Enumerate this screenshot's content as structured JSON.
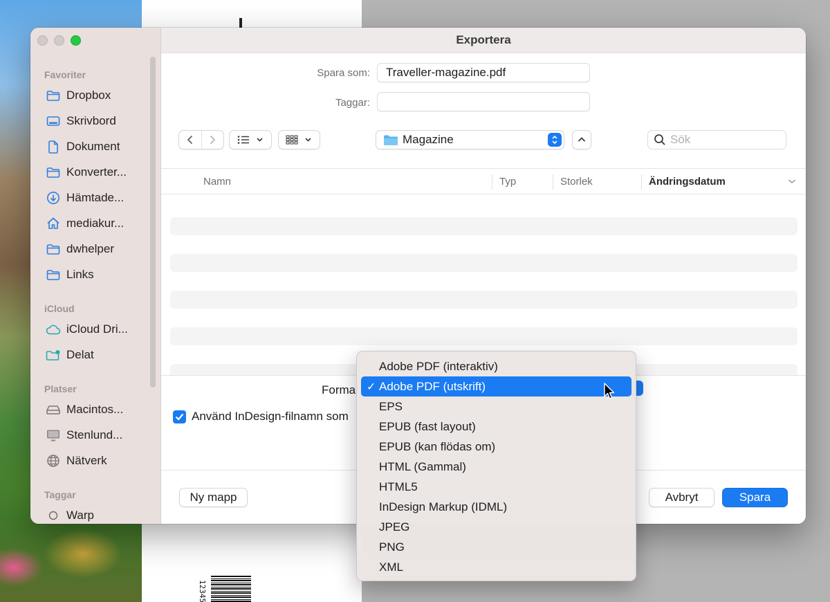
{
  "window": {
    "title": "Exportera"
  },
  "sidebar": {
    "sections": [
      {
        "title": "Favoriter",
        "items": [
          {
            "label": "Dropbox",
            "icon": "folder-icon"
          },
          {
            "label": "Skrivbord",
            "icon": "desktop-icon"
          },
          {
            "label": "Dokument",
            "icon": "document-icon"
          },
          {
            "label": "Konverter...",
            "icon": "folder-icon"
          },
          {
            "label": "Hämtade...",
            "icon": "download-icon"
          },
          {
            "label": "mediakur...",
            "icon": "home-icon"
          },
          {
            "label": "dwhelper",
            "icon": "folder-icon"
          },
          {
            "label": "Links",
            "icon": "folder-icon"
          }
        ]
      },
      {
        "title": "iCloud",
        "items": [
          {
            "label": "iCloud Dri...",
            "icon": "cloud-icon"
          },
          {
            "label": "Delat",
            "icon": "shared-folder-icon"
          }
        ]
      },
      {
        "title": "Platser",
        "items": [
          {
            "label": "Macintos...",
            "icon": "hard-drive-icon"
          },
          {
            "label": "Stenlund...",
            "icon": "monitor-icon"
          },
          {
            "label": "Nätverk",
            "icon": "globe-icon"
          }
        ]
      },
      {
        "title": "Taggar",
        "items": [
          {
            "label": "Warp",
            "icon": "tag-circle-icon"
          }
        ]
      }
    ]
  },
  "form": {
    "save_as_label": "Spara som:",
    "save_as_value": "Traveller-magazine.pdf",
    "tags_label": "Taggar:",
    "tags_value": ""
  },
  "toolbar": {
    "location": "Magazine",
    "search_placeholder": "Sök"
  },
  "columns": [
    "Namn",
    "Typ",
    "Storlek",
    "Ändringsdatum"
  ],
  "options": {
    "format_label": "Forma",
    "checkbox_label": "Använd InDesign-filnamn som",
    "checkbox_checked": true
  },
  "buttons": {
    "new_folder": "Ny mapp",
    "cancel": "Avbryt",
    "save": "Spara"
  },
  "format_menu": {
    "selected": "Adobe PDF (utskrift)",
    "check_glyph": "✓",
    "items": [
      "Adobe PDF (interaktiv)",
      "Adobe PDF (utskrift)",
      "EPS",
      "EPUB (fast layout)",
      "EPUB (kan flödas om)",
      "HTML (Gammal)",
      "HTML5",
      "InDesign Markup (IDML)",
      "JPEG",
      "PNG",
      "XML"
    ]
  },
  "background": {
    "barcode_digits": "12345"
  },
  "colors": {
    "accent": "#1a7bf2",
    "sidebar_icon": "#2f7fe0",
    "traffic_green": "#28c840"
  }
}
